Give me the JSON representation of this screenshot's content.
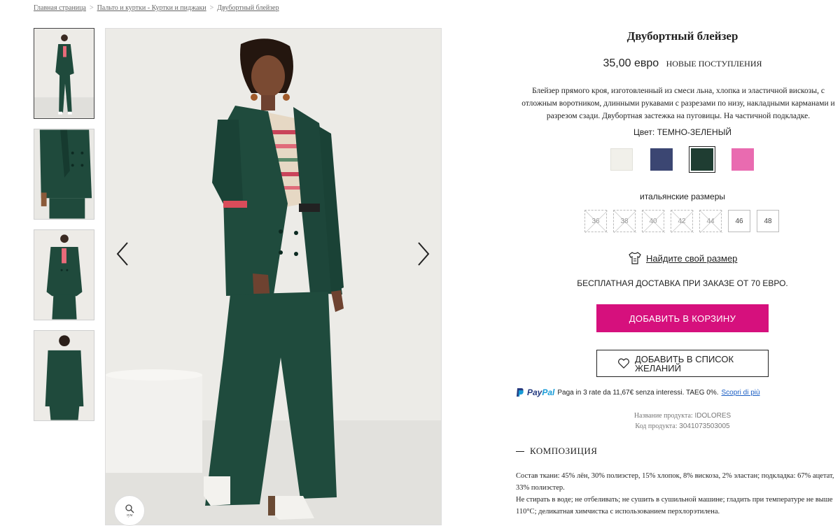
{
  "breadcrumb": {
    "items": [
      "Главная страница",
      "Пальто и куртки - Куртки и пиджаки",
      "Двубортный блейзер"
    ],
    "separator": ">"
  },
  "gallery": {
    "thumbnails": [
      "front-full",
      "detail",
      "front-full-alt",
      "back-full"
    ],
    "zoom_label": "зум"
  },
  "product": {
    "title": "Двубортный блейзер",
    "price": "35,00 евро",
    "badge": "НОВЫЕ ПОСТУПЛЕНИЯ",
    "description": "Блейзер прямого кроя, изготовленный из смеси льна, хлопка и эластичной вискозы, с отложным воротником, длинными рукавами с разрезами по низу, накладными карманами и разрезом сзади. Двубортная застежка на пуговицы. На частичной подкладке.",
    "color_label": "Цвет: ТЕМНО-ЗЕЛЕНЫЙ",
    "colors": [
      {
        "name": "cream",
        "hex": "#f1f0ea"
      },
      {
        "name": "navy",
        "hex": "#3b4672"
      },
      {
        "name": "dark-green",
        "hex": "#1f3d32"
      },
      {
        "name": "pink",
        "hex": "#e96bb0"
      }
    ],
    "selected_color_index": 2,
    "size_label": "итальянские размеры",
    "sizes": [
      {
        "label": "36",
        "available": false
      },
      {
        "label": "38",
        "available": false
      },
      {
        "label": "40",
        "available": false
      },
      {
        "label": "42",
        "available": false
      },
      {
        "label": "44",
        "available": false
      },
      {
        "label": "46",
        "available": true
      },
      {
        "label": "48",
        "available": true
      }
    ],
    "find_size": "Найдите свой размер",
    "shipping": "БЕСПЛАТНАЯ ДОСТАВКА ПРИ ЗАКАЗЕ ОТ 70 ЕВРО.",
    "add_to_cart": "ДОБАВИТЬ В КОРЗИНУ",
    "add_to_wishlist": "ДОБАВИТЬ В СПИСОК ЖЕЛАНИЙ",
    "accent_color": "#d6107d"
  },
  "paypal": {
    "logo_part1": "Pay",
    "logo_part2": "Pal",
    "text": "Paga in 3 rate da 11,67€ senza interessi. TAEG 0%.",
    "link": "Scopri di più"
  },
  "meta": {
    "name_key": "Название продукта:",
    "name_value": "IDOLORES",
    "code_key": "Код продукта:",
    "code_value": "3041073503005"
  },
  "composition": {
    "heading": "КОМПОЗИЦИЯ",
    "text1": "Состав ткани: 45% лён, 30% полиэстер, 15% хлопок, 8% вискоза, 2% эластан; подкладка: 67% ацетат, 33% полиэстер.",
    "text2": "Не стирать в воде; не отбеливать; не сушить в сушильной машине; гладить при температуре не выше 110°C; деликатная химчистка с использованием перхлорэтилена."
  }
}
